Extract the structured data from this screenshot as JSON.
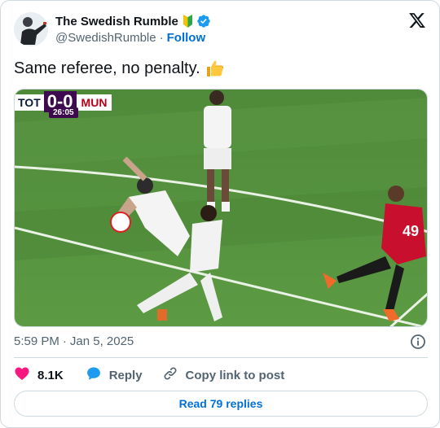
{
  "author": {
    "display_name": "The Swedish Rumble",
    "handle": "@SwedishRumble",
    "follow_label": "Follow",
    "separator": "·"
  },
  "post": {
    "text": "Same referee, no penalty."
  },
  "scoreboard": {
    "home": "TOT",
    "score": "0-0",
    "away": "MUN",
    "clock": "26:05",
    "away_shirt_number": "49"
  },
  "meta": {
    "time": "5:59 PM",
    "date": "Jan 5, 2025",
    "separator": "·"
  },
  "actions": {
    "like_count": "8.1K",
    "reply_label": "Reply",
    "copy_label": "Copy link to post"
  },
  "replies": {
    "read_label": "Read 79 replies"
  },
  "icons": {
    "x_logo": "x-logo-icon",
    "verified": "verified-badge-icon",
    "beginner": "beginner-badge-icon",
    "thumbs": "thumbs-up-icon",
    "info": "info-icon",
    "heart": "heart-icon",
    "reply": "reply-bubble-icon",
    "link": "link-icon"
  },
  "colors": {
    "accent": "#006fd6",
    "like": "#f91880",
    "verified": "#1d9bf0",
    "muted": "#536471",
    "text": "#0f1419"
  }
}
